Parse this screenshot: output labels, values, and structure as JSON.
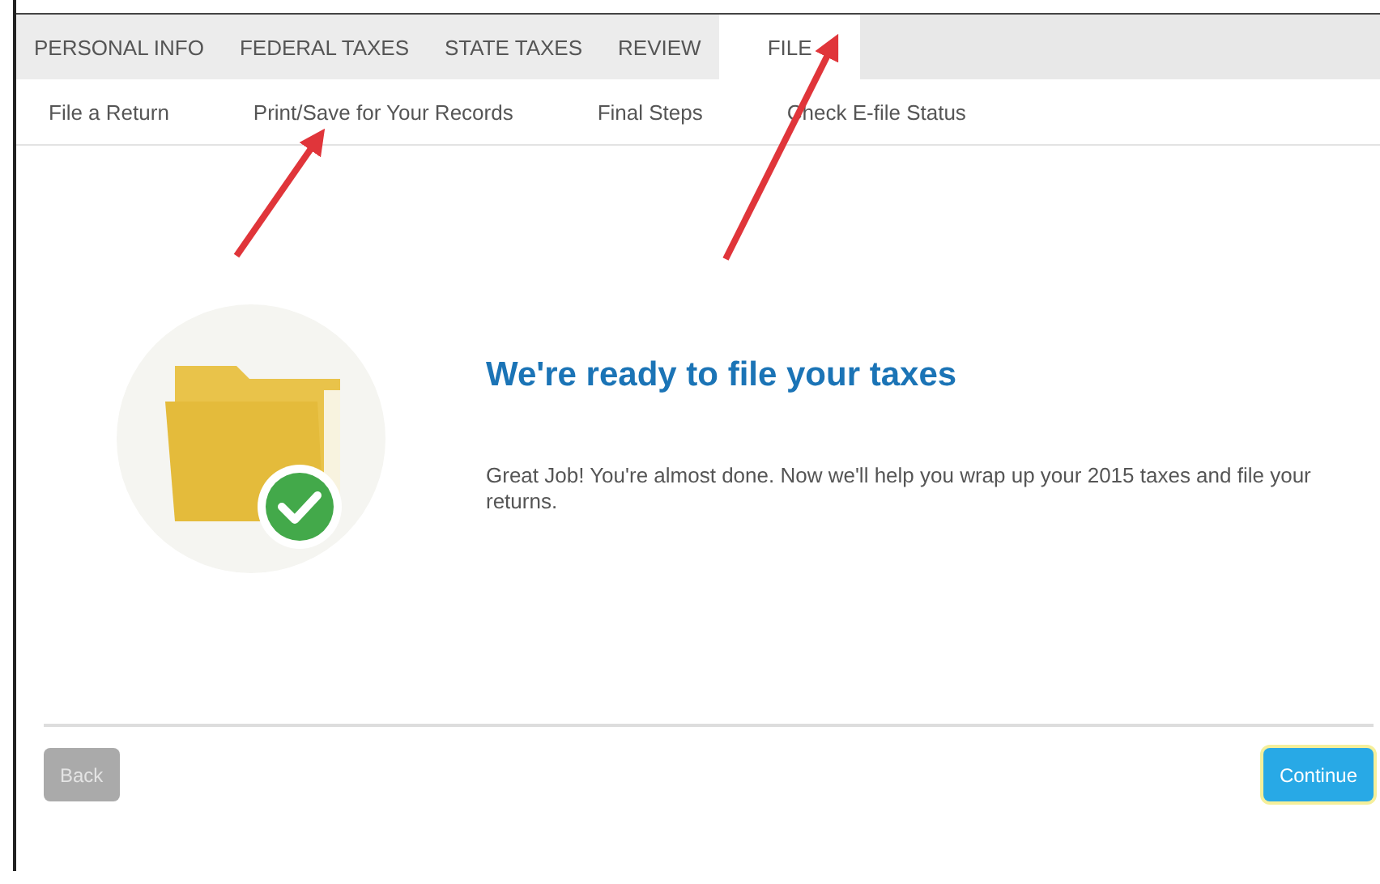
{
  "tabs": [
    {
      "label": "PERSONAL INFO",
      "selected": false
    },
    {
      "label": "FEDERAL TAXES",
      "selected": false
    },
    {
      "label": "STATE TAXES",
      "selected": false
    },
    {
      "label": "REVIEW",
      "selected": false
    },
    {
      "label": "FILE",
      "selected": true
    }
  ],
  "subnav": [
    {
      "label": "File a Return"
    },
    {
      "label": "Print/Save for Your Records"
    },
    {
      "label": "Final Steps"
    },
    {
      "label": "Check E-file Status"
    }
  ],
  "heading": "We're ready to file your taxes",
  "message": "Great Job! You're almost done. Now we'll help you wrap up your 2015 taxes and file your returns.",
  "buttons": [
    {
      "label": "Back",
      "kind": "secondary",
      "disabled": true
    },
    {
      "label": "Continue",
      "kind": "primary",
      "disabled": false
    }
  ]
}
